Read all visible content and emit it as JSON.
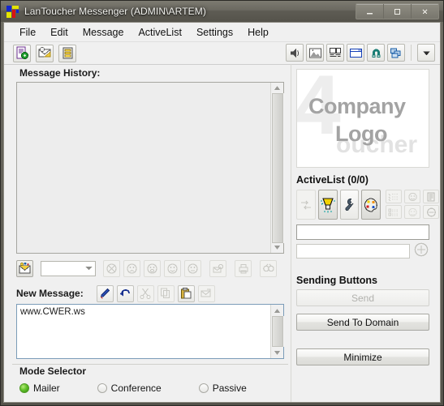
{
  "window": {
    "title": "LanToucher Messenger (ADMIN\\ARTEM)",
    "icon": "lantoucher-logo-icon",
    "controls": {
      "minimize": "minimize-window-button",
      "maximize": "maximize-window-button",
      "close": "close-window-button"
    }
  },
  "menubar": {
    "items": [
      {
        "label": "File"
      },
      {
        "label": "Edit"
      },
      {
        "label": "Message"
      },
      {
        "label": "ActiveList"
      },
      {
        "label": "Settings"
      },
      {
        "label": "Help"
      }
    ]
  },
  "toolbar": {
    "left": [
      {
        "name": "new-message-icon",
        "enabled": true
      },
      {
        "name": "open-message-icon",
        "enabled": true
      },
      {
        "name": "message-list-icon",
        "enabled": true
      }
    ],
    "right": [
      {
        "name": "sound-icon",
        "enabled": true
      },
      {
        "name": "image-icon",
        "enabled": true
      },
      {
        "name": "monitor-icon",
        "enabled": true
      },
      {
        "name": "window-icon",
        "enabled": true
      },
      {
        "name": "magnet-icon",
        "enabled": true
      },
      {
        "name": "windows-cascade-icon",
        "enabled": true
      },
      {
        "name": "dropdown-arrow-icon",
        "enabled": true
      }
    ]
  },
  "message_history": {
    "label": "Message History:",
    "content": "",
    "scrollbar": {
      "up": "scroll-up-arrow",
      "down": "scroll-down-arrow"
    },
    "tools": [
      {
        "name": "history-emoticon-icon",
        "enabled": true
      },
      {
        "name": "emoticon-cross-icon",
        "enabled": false
      },
      {
        "name": "emoticon-sad-icon",
        "enabled": false
      },
      {
        "name": "emoticon-surprised-icon",
        "enabled": false
      },
      {
        "name": "emoticon-smile-icon",
        "enabled": false
      },
      {
        "name": "emoticon-neutral-icon",
        "enabled": false
      },
      {
        "name": "save-history-icon",
        "enabled": false
      },
      {
        "name": "print-icon",
        "enabled": false
      },
      {
        "name": "find-icon",
        "enabled": false
      }
    ],
    "combo": {
      "value": "",
      "placeholder": ""
    }
  },
  "new_message": {
    "label": "New Message:",
    "value": "www.CWER.ws",
    "tools": [
      {
        "name": "pen-icon",
        "enabled": true
      },
      {
        "name": "undo-icon",
        "enabled": true
      },
      {
        "name": "cut-icon",
        "enabled": false
      },
      {
        "name": "copy-icon",
        "enabled": false
      },
      {
        "name": "paste-icon",
        "enabled": true
      },
      {
        "name": "send-file-icon",
        "enabled": false
      }
    ]
  },
  "mode_selector": {
    "label": "Mode Selector",
    "options": [
      {
        "label": "Mailer",
        "selected": true
      },
      {
        "label": "Conference",
        "selected": false
      },
      {
        "label": "Passive",
        "selected": false
      }
    ],
    "selected_color": "#62c12a"
  },
  "logo": {
    "line1": "Company",
    "line2": "Logo",
    "watermark": "4",
    "watermark2": "oucher"
  },
  "activelist": {
    "label": "ActiveList (0/0)",
    "buttons": [
      {
        "name": "refresh-icon",
        "enabled": false
      },
      {
        "name": "lamp-icon",
        "enabled": true
      },
      {
        "name": "wrench-icon",
        "enabled": true
      },
      {
        "name": "palette-icon",
        "enabled": true
      }
    ],
    "grid_buttons": [
      {
        "name": "list-check-icon",
        "enabled": false
      },
      {
        "name": "face-select-icon",
        "enabled": false
      },
      {
        "name": "document-icon",
        "enabled": false
      },
      {
        "name": "list-item-icon",
        "enabled": false
      },
      {
        "name": "face-deselect-icon",
        "enabled": false
      },
      {
        "name": "minus-circle-icon",
        "enabled": false
      }
    ],
    "input_top": {
      "value": "",
      "placeholder": ""
    },
    "input_bottom": {
      "value": "",
      "placeholder": ""
    },
    "add_button": {
      "name": "plus-circle-icon",
      "enabled": false
    }
  },
  "sending": {
    "label": "Sending Buttons",
    "send": {
      "label": "Send",
      "enabled": false
    },
    "send_domain": {
      "label": "Send To Domain",
      "enabled": true
    }
  },
  "minimize": {
    "label": "Minimize",
    "enabled": true
  }
}
